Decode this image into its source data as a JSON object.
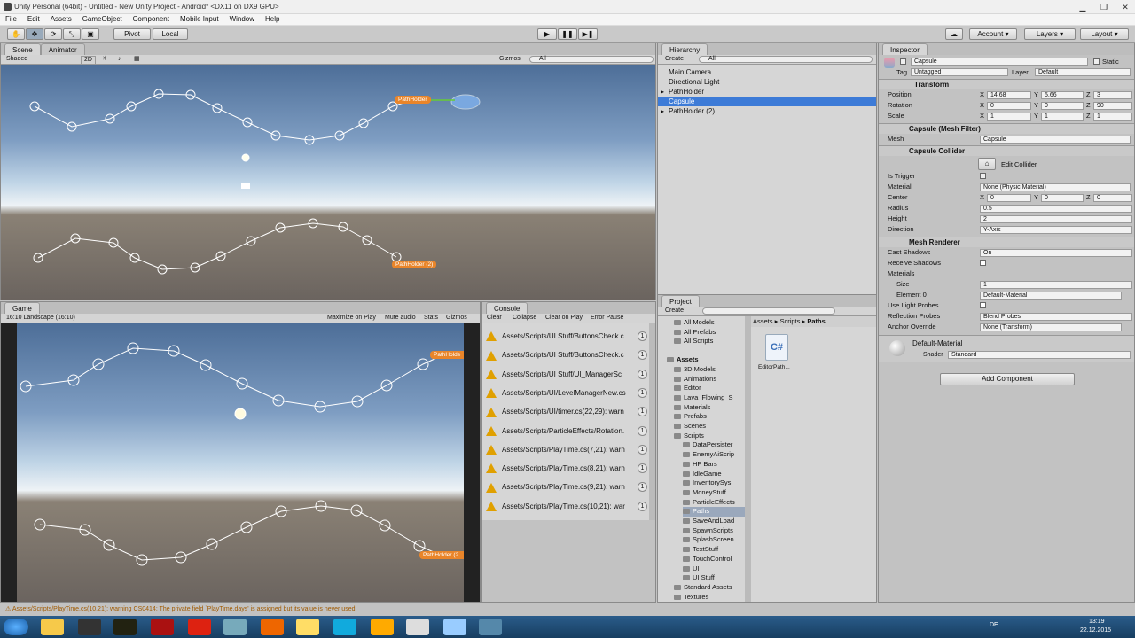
{
  "window": {
    "title": "Unity Personal (64bit) - Untitled - New Unity Project - Android* <DX11 on DX9 GPU>"
  },
  "menu": [
    "File",
    "Edit",
    "Assets",
    "GameObject",
    "Component",
    "Mobile Input",
    "Window",
    "Help"
  ],
  "toolbar": {
    "pivot": "Pivot",
    "local": "Local",
    "account": "Account",
    "layers": "Layers",
    "layout": "Layout"
  },
  "scene": {
    "tab": "Scene",
    "tab2": "Animator",
    "shading": "Shaded",
    "mode2d": "2D",
    "gizmos": "Gizmos",
    "search": "All",
    "path1": "PathHolder",
    "path2": "PathHolder (2)"
  },
  "game": {
    "tab": "Game",
    "aspect": "16:10 Landscape (16:10)",
    "maximize": "Maximize on Play",
    "mute": "Mute audio",
    "stats": "Stats",
    "gizmos": "Gizmos",
    "path1": "PathHolde",
    "path2": "PathHolder (2"
  },
  "console": {
    "tab": "Console",
    "clear": "Clear",
    "collapse": "Collapse",
    "clear_on_play": "Clear on Play",
    "error_pause": "Error Pause",
    "messages": [
      {
        "text": "Assets/Scripts/UI Stuff/ButtonsCheck.c",
        "count": "1"
      },
      {
        "text": "Assets/Scripts/UI Stuff/ButtonsCheck.c",
        "count": "1"
      },
      {
        "text": "Assets/Scripts/UI Stuff/UI_ManagerSc",
        "count": "1"
      },
      {
        "text": "Assets/Scripts/UI/LevelManagerNew.cs",
        "count": "1"
      },
      {
        "text": "Assets/Scripts/UI/timer.cs(22,29): warn",
        "count": "1"
      },
      {
        "text": "Assets/Scripts/ParticleEffects/Rotation.",
        "count": "1"
      },
      {
        "text": "Assets/Scripts/PlayTime.cs(7,21): warn",
        "count": "1"
      },
      {
        "text": "Assets/Scripts/PlayTime.cs(8,21): warn",
        "count": "1"
      },
      {
        "text": "Assets/Scripts/PlayTime.cs(9,21): warn",
        "count": "1"
      },
      {
        "text": "Assets/Scripts/PlayTime.cs(10,21): war",
        "count": "1"
      }
    ]
  },
  "hierarchy": {
    "tab": "Hierarchy",
    "create": "Create",
    "search": "All",
    "items": [
      "Main Camera",
      "Directional Light",
      "PathHolder",
      "Capsule",
      "PathHolder (2)"
    ]
  },
  "project": {
    "tab": "Project",
    "create": "Create",
    "favorites": [
      "All Models",
      "All Prefabs",
      "All Scripts"
    ],
    "assets_root": "Assets",
    "folders": [
      "3D Models",
      "Animations",
      "Editor",
      "Lava_Flowing_S",
      "Materials",
      "Prefabs",
      "Scenes",
      "Scripts"
    ],
    "script_folders": [
      "DataPersister",
      "EnemyAiScrip",
      "HP Bars",
      "IdleGame",
      "InventorySys",
      "MoneyStuff",
      "ParticleEffects",
      "Paths",
      "SaveAndLoad",
      "SpawnScripts",
      "SplashScreen",
      "TextStuff",
      "TouchControl",
      "UI",
      "UI Stuff"
    ],
    "after": [
      "Standard Assets",
      "Textures"
    ],
    "breadcrumb": [
      "Assets",
      "Scripts",
      "Paths"
    ],
    "file": "EditorPath..."
  },
  "inspector": {
    "tab": "Inspector",
    "name": "Capsule",
    "static": "Static",
    "tag_label": "Tag",
    "tag": "Untagged",
    "layer_label": "Layer",
    "layer": "Default",
    "transform": {
      "title": "Transform",
      "position": {
        "label": "Position",
        "x": "14.68",
        "y": "5.66",
        "z": "3"
      },
      "rotation": {
        "label": "Rotation",
        "x": "0",
        "y": "0",
        "z": "90"
      },
      "scale": {
        "label": "Scale",
        "x": "1",
        "y": "1",
        "z": "1"
      }
    },
    "meshfilter": {
      "title": "Capsule (Mesh Filter)",
      "mesh_label": "Mesh",
      "mesh": "Capsule"
    },
    "collider": {
      "title": "Capsule Collider",
      "edit": "Edit Collider",
      "is_trigger": "Is Trigger",
      "material_label": "Material",
      "material": "None (Physic Material)",
      "center_label": "Center",
      "cx": "0",
      "cy": "0",
      "cz": "0",
      "radius_label": "Radius",
      "radius": "0.5",
      "height_label": "Height",
      "height": "2",
      "direction_label": "Direction",
      "direction": "Y-Axis"
    },
    "renderer": {
      "title": "Mesh Renderer",
      "cast_label": "Cast Shadows",
      "cast": "On",
      "receive_label": "Receive Shadows",
      "materials_label": "Materials",
      "size_label": "Size",
      "size": "1",
      "element_label": "Element 0",
      "element": "Default-Material",
      "light_probes_label": "Use Light Probes",
      "refl_label": "Reflection Probes",
      "refl": "Blend Probes",
      "anchor_label": "Anchor Override",
      "anchor": "None (Transform)"
    },
    "material": {
      "name": "Default-Material",
      "shader_label": "Shader",
      "shader": "Standard"
    },
    "add_component": "Add Component"
  },
  "status": "Assets/Scripts/PlayTime.cs(10,21): warning CS0414: The private field `PlayTime.days' is assigned but its value is never used",
  "clock": {
    "time": "13:19",
    "date": "22.12.2015",
    "lang": "DE"
  }
}
